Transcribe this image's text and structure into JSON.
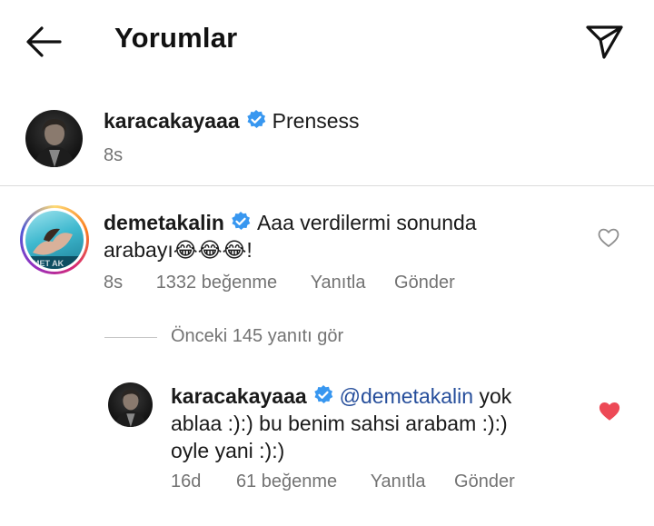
{
  "header": {
    "back_icon": "arrow-left-icon",
    "title": "Yorumlar",
    "send_icon": "paper-plane-icon"
  },
  "caption": {
    "username": "karacakayaaa",
    "text": "Prensess",
    "time": "8s"
  },
  "comment": {
    "username": "demetakalin",
    "text_line1": "Aaa verdilermi sonunda",
    "text_line2": "arabayı😂😂😂!",
    "time": "8s",
    "likes": "1332 beğenme",
    "reply": "Yanıtla",
    "send": "Gönder",
    "liked": false
  },
  "view_replies": "Önceki 145 yanıtı gör",
  "reply": {
    "username": "karacakayaaa",
    "mention": "@demetakalin",
    "text_line1_rest": "yok",
    "text_line2": "ablaa :):) bu benim sahsi arabam :):)",
    "text_line3": "oyle yani :):)",
    "time": "16d",
    "likes": "61 beğenme",
    "reply": "Yanıtla",
    "send": "Gönder",
    "liked": true
  },
  "colors": {
    "verified_blue": "#3897f0",
    "like_red": "#ed4956",
    "meta_gray": "#737373",
    "mention_blue": "#264e9b"
  }
}
